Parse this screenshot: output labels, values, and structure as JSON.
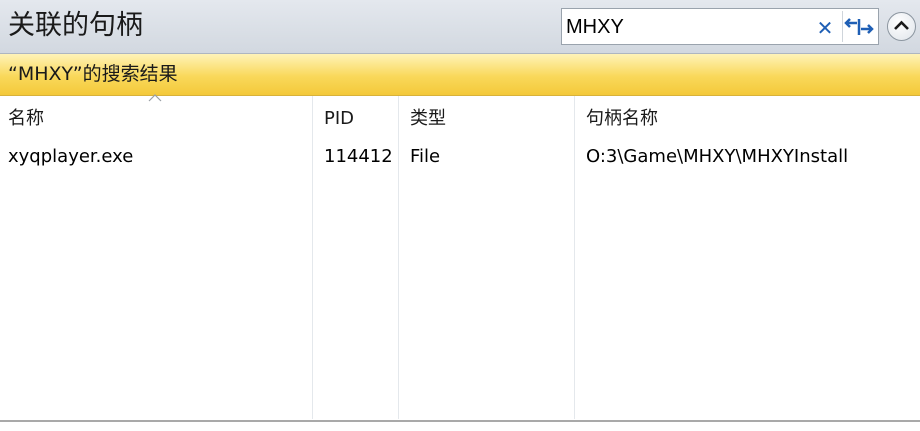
{
  "window": {
    "title": "关联的句柄"
  },
  "search": {
    "value": "MHXY",
    "clear_icon": "close-icon",
    "option_icon": "search-options-icon"
  },
  "collapse_icon": "chevron-up-icon",
  "banner": {
    "text": "“MHXY”的搜索结果"
  },
  "table": {
    "columns": [
      "名称",
      "PID",
      "类型",
      "句柄名称"
    ],
    "sort_column": "名称",
    "rows": [
      {
        "name": "xyqplayer.exe",
        "pid": "114412",
        "type": "File",
        "handle": "O:3\\Game\\MHXY\\MHXYInstall"
      }
    ]
  },
  "colors": {
    "accent": "#1f5fb5",
    "banner": "#f9d85a"
  }
}
